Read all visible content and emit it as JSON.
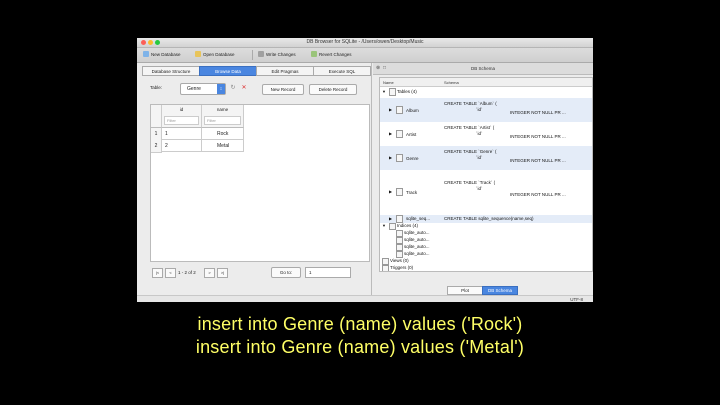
{
  "window": {
    "title": "DB Browser for SQLite - /Users/owen/Desktop/Music"
  },
  "toolbar": {
    "new_db": "New Database",
    "open_db": "Open Database",
    "write_changes": "Write Changes",
    "revert_changes": "Revert Changes"
  },
  "tabs": [
    "Database Structure",
    "Browse Data",
    "Edit Pragmas",
    "Execute SQL"
  ],
  "browse": {
    "table_label": "Table:",
    "table_value": "Genre",
    "new_record": "New Record",
    "delete_record": "Delete Record",
    "columns": [
      {
        "name": "id",
        "filter_placeholder": "Filter"
      },
      {
        "name": "name",
        "filter_placeholder": "Filter"
      }
    ],
    "rows": [
      {
        "num": "1",
        "id": "1",
        "name": "Rock"
      },
      {
        "num": "2",
        "id": "2",
        "name": "Metal"
      }
    ],
    "nav_first": "|<",
    "nav_prev": "<",
    "page_text": "1 - 2 of 2",
    "nav_next": ">",
    "nav_last": ">|",
    "goto_label": "Go to:",
    "goto_value": "1"
  },
  "schema": {
    "header": "DB Schema",
    "col_name": "Name",
    "col_schema": "Schema",
    "tables_label": "Tables (4)",
    "tables": [
      {
        "name": "Album",
        "sql": "CREATE TABLE `Album` (",
        "sql2": "`id`",
        "type": "INTEGER NOT NULL PR ..."
      },
      {
        "name": "Artist",
        "sql": "CREATE TABLE `Artist` (",
        "sql2": "`id`",
        "type": "INTEGER NOT NULL PR ..."
      },
      {
        "name": "Genre",
        "sql": "CREATE TABLE `Genre` (",
        "sql2": "`id`",
        "type": "INTEGER NOT NULL PR ..."
      },
      {
        "name": "Track",
        "sql": "CREATE TABLE `Track` (",
        "sql2": "`id`",
        "type": "INTEGER NOT NULL PR ..."
      },
      {
        "name": "sqlite_seq...",
        "sql": "CREATE TABLE sqlite_sequence(name,seq)"
      }
    ],
    "indices_label": "Indices (4)",
    "indices": [
      "sqlite_auto...",
      "sqlite_auto...",
      "sqlite_auto...",
      "sqlite_auto..."
    ],
    "views_label": "Views (0)",
    "triggers_label": "Triggers (0)",
    "bottom_tabs": [
      "Plot",
      "DB Schema"
    ]
  },
  "status": {
    "encoding": "UTF-8"
  },
  "caption": {
    "line1": "insert into Genre (name) values ('Rock')",
    "line2": "insert into Genre (name) values ('Metal')"
  }
}
